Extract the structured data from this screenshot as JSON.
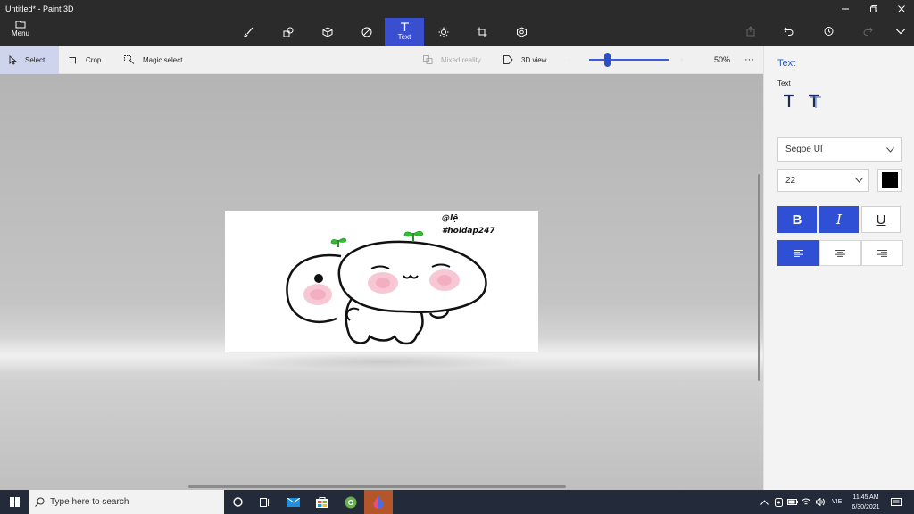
{
  "window": {
    "title": "Untitled* - Paint 3D"
  },
  "menu": {
    "label": "Menu"
  },
  "toolbar": {
    "tools": [
      {
        "icon": "brushes-icon"
      },
      {
        "icon": "2d-shapes-icon"
      },
      {
        "icon": "3d-shapes-icon"
      },
      {
        "icon": "stickers-icon"
      },
      {
        "icon": "text-icon",
        "label": "Text",
        "active": true
      },
      {
        "icon": "effects-icon"
      },
      {
        "icon": "canvas-icon"
      },
      {
        "icon": "3d-library-icon"
      }
    ]
  },
  "subtoolbar": {
    "select_label": "Select",
    "crop_label": "Crop",
    "magic_select_label": "Magic select",
    "mixed_reality_label": "Mixed reality",
    "view_3d_label": "3D view",
    "zoom_value": "50%",
    "zoom_fraction": 0.25
  },
  "canvas": {
    "text_line1": "@lệ",
    "text_line2": "#hoidap247"
  },
  "panel": {
    "title": "Text",
    "section_label": "Text",
    "font_family": "Segoe UI",
    "font_size": "22",
    "text_color": "#000000",
    "bold_label": "B",
    "italic_label": "I",
    "underline_label": "U"
  },
  "taskbar": {
    "search_placeholder": "Type here to search",
    "language": "VIE",
    "time": "11:45 AM",
    "date": "6/30/2021"
  },
  "colors": {
    "accent": "#3a4fd0",
    "titlebar": "#2b2b2b",
    "taskbar": "#232a3a"
  }
}
